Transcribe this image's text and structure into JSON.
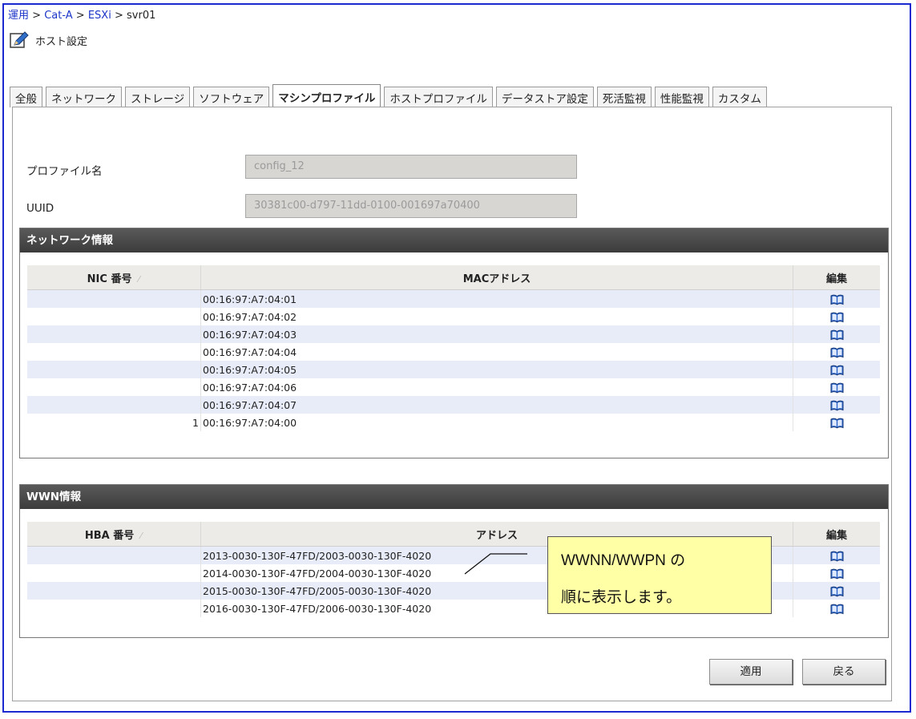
{
  "breadcrumb": {
    "items": [
      "運用",
      "Cat-A",
      "ESXi"
    ],
    "separator": ">",
    "current": "svr01"
  },
  "header": {
    "title": "ホスト設定",
    "icon": "edit-icon"
  },
  "tabs": [
    {
      "label": "全般",
      "active": false
    },
    {
      "label": "ネットワーク",
      "active": false
    },
    {
      "label": "ストレージ",
      "active": false
    },
    {
      "label": "ソフトウェア",
      "active": false
    },
    {
      "label": "マシンプロファイル",
      "active": true
    },
    {
      "label": "ホストプロファイル",
      "active": false
    },
    {
      "label": "データストア設定",
      "active": false
    },
    {
      "label": "死活監視",
      "active": false
    },
    {
      "label": "性能監視",
      "active": false
    },
    {
      "label": "カスタム",
      "active": false
    }
  ],
  "form": {
    "profile_label": "プロファイル名",
    "profile_value": "config_12",
    "uuid_label": "UUID",
    "uuid_value": "30381c00-d797-11dd-0100-001697a70400"
  },
  "network_section": {
    "title": "ネットワーク情報",
    "columns": [
      "NIC 番号",
      "MACアドレス",
      "編集"
    ],
    "rows": [
      {
        "no": "",
        "address": "00:16:97:A7:04:01"
      },
      {
        "no": "",
        "address": "00:16:97:A7:04:02"
      },
      {
        "no": "",
        "address": "00:16:97:A7:04:03"
      },
      {
        "no": "",
        "address": "00:16:97:A7:04:04"
      },
      {
        "no": "",
        "address": "00:16:97:A7:04:05"
      },
      {
        "no": "",
        "address": "00:16:97:A7:04:06"
      },
      {
        "no": "",
        "address": "00:16:97:A7:04:07"
      },
      {
        "no": "1",
        "address": "00:16:97:A7:04:00"
      }
    ]
  },
  "wwn_section": {
    "title": "WWN情報",
    "columns": [
      "HBA 番号",
      "アドレス",
      "編集"
    ],
    "rows": [
      {
        "no": "",
        "address": "2013-0030-130F-47FD/2003-0030-130F-4020"
      },
      {
        "no": "",
        "address": "2014-0030-130F-47FD/2004-0030-130F-4020"
      },
      {
        "no": "",
        "address": "2015-0030-130F-47FD/2005-0030-130F-4020"
      },
      {
        "no": "",
        "address": "2016-0030-130F-47FD/2006-0030-130F-4020"
      }
    ]
  },
  "buttons": {
    "apply": "適用",
    "back": "戻る"
  },
  "callout": {
    "line1": "WWNN/WWPN の",
    "line2": "順に表示します。"
  },
  "colors": {
    "link": "#1c35c8",
    "frame": "#1a2ad0",
    "row_alt": "#e8ecf8",
    "section_header": "#4a4a4a",
    "callout_bg": "#ffffa6"
  }
}
